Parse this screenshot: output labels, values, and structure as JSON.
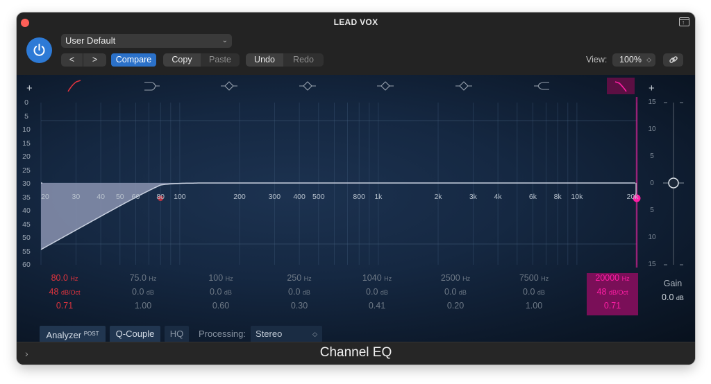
{
  "window": {
    "title": "LEAD VOX",
    "plugin_name": "Channel EQ"
  },
  "header": {
    "preset": "User Default",
    "nav_prev": "<",
    "nav_next": ">",
    "compare_label": "Compare",
    "copy_label": "Copy",
    "paste_label": "Paste",
    "undo_label": "Undo",
    "redo_label": "Redo",
    "view_label": "View:",
    "view_value": "100%",
    "link_icon": "link-icon",
    "power_icon": "power-icon"
  },
  "graph": {
    "plus_left": "+",
    "plus_right": "+",
    "left_scale": [
      "0",
      "5",
      "10",
      "15",
      "20",
      "25",
      "30",
      "35",
      "40",
      "45",
      "50",
      "55",
      "60"
    ],
    "right_scale": [
      "15",
      "10",
      "5",
      "0",
      "5",
      "10",
      "15"
    ],
    "freq_labels": [
      "20",
      "30",
      "40",
      "50",
      "60",
      "80",
      "100",
      "200",
      "300",
      "400",
      "500",
      "800",
      "1k",
      "2k",
      "3k",
      "4k",
      "6k",
      "8k",
      "10k",
      "20k"
    ],
    "band_types": [
      "low-cut",
      "low-shelf",
      "bell",
      "bell",
      "bell",
      "bell",
      "high-shelf",
      "high-cut"
    ]
  },
  "bands": [
    {
      "freq": "80.0",
      "freq_unit": "Hz",
      "gain": "48",
      "gain_unit": "dB/Oct",
      "q": "0.71",
      "state": "active-red"
    },
    {
      "freq": "75.0",
      "freq_unit": "Hz",
      "gain": "0.0",
      "gain_unit": "dB",
      "q": "1.00",
      "state": "off"
    },
    {
      "freq": "100",
      "freq_unit": "Hz",
      "gain": "0.0",
      "gain_unit": "dB",
      "q": "0.60",
      "state": "off"
    },
    {
      "freq": "250",
      "freq_unit": "Hz",
      "gain": "0.0",
      "gain_unit": "dB",
      "q": "0.30",
      "state": "off"
    },
    {
      "freq": "1040",
      "freq_unit": "Hz",
      "gain": "0.0",
      "gain_unit": "dB",
      "q": "0.41",
      "state": "off"
    },
    {
      "freq": "2500",
      "freq_unit": "Hz",
      "gain": "0.0",
      "gain_unit": "dB",
      "q": "0.20",
      "state": "off"
    },
    {
      "freq": "7500",
      "freq_unit": "Hz",
      "gain": "0.0",
      "gain_unit": "dB",
      "q": "1.00",
      "state": "off"
    },
    {
      "freq": "20000",
      "freq_unit": "Hz",
      "gain": "48",
      "gain_unit": "dB/Oct",
      "q": "0.71",
      "state": "active-pink"
    }
  ],
  "master_gain": {
    "label": "Gain",
    "value": "0.0",
    "unit": "dB"
  },
  "footer_controls": {
    "analyzer_label": "Analyzer",
    "analyzer_sup": "POST",
    "qcouple_label": "Q-Couple",
    "hq_label": "HQ",
    "processing_label": "Processing:",
    "processing_value": "Stereo"
  },
  "colors": {
    "accent_blue": "#2b71c9",
    "band_red": "#e0343e",
    "band_pink": "#ff1ea5",
    "curve_fill": "#8a93b0"
  }
}
